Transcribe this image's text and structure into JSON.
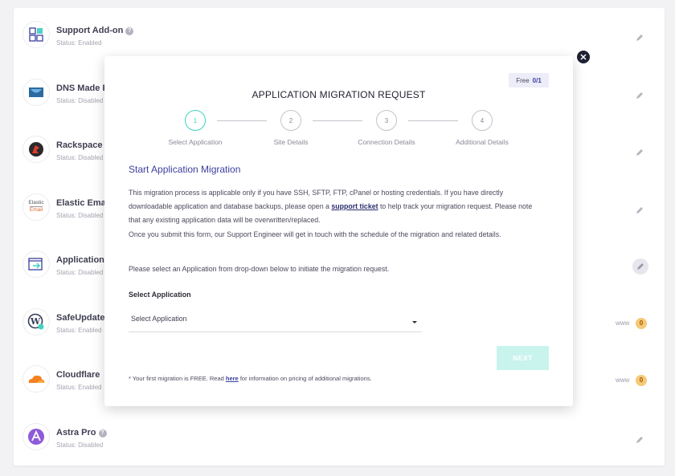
{
  "addons": [
    {
      "name": "Support Add-on",
      "status": "Status: Enabled",
      "icon": "support-grid-icon",
      "help": true
    },
    {
      "name": "DNS Made E",
      "status": "Status: Disabled",
      "icon": "dns-made-easy-icon",
      "help": false
    },
    {
      "name": "Rackspace E",
      "status": "Status: Disabled",
      "icon": "rackspace-icon",
      "help": false
    },
    {
      "name": "Elastic Emai",
      "status": "Status: Disabled",
      "icon": "elastic-email-icon",
      "icon_text_top": "Elastic",
      "icon_text_bottom": "Email",
      "help": false
    },
    {
      "name": "Application",
      "status": "Status: Disabled",
      "icon": "application-migration-icon",
      "help": false
    },
    {
      "name": "SafeUpdate",
      "status": "Status: Enabled",
      "icon": "wordpress-icon",
      "help": false,
      "www": "www",
      "count": "0"
    },
    {
      "name": "Cloudflare",
      "status": "Status: Enabled",
      "icon": "cloudflare-icon",
      "help": false,
      "www": "www",
      "count": "0"
    },
    {
      "name": "Astra Pro",
      "status": "Status: Disabled",
      "icon": "astra-icon",
      "help": true
    }
  ],
  "modal": {
    "free_label": "Free",
    "free_count": "0/1",
    "title": "APPLICATION MIGRATION REQUEST",
    "steps": [
      {
        "number": "1",
        "label": "Select Application"
      },
      {
        "number": "2",
        "label": "Site Details"
      },
      {
        "number": "3",
        "label": "Connection Details"
      },
      {
        "number": "4",
        "label": "Additional Details"
      }
    ],
    "section_title": "Start Application Migration",
    "desc_part1": "This migration process is applicable only if you have SSH, SFTP, FTP, cPanel or hosting credentials. If you have directly downloadable application and database backups, please open a ",
    "desc_link": "support ticket",
    "desc_part2": " to help track your migration request. Please note that any existing application data will be overwritten/replaced.",
    "desc_part3": "Once you submit this form, our Support Engineer will get in touch with the schedule of the migration and related details.",
    "desc_select": "Please select an Application from drop-down below to initiate the migration request.",
    "select_label": "Select Application",
    "select_value": "Select Application",
    "next_label": "NEXT",
    "footnote_part1": "* Your first migration is FREE. Read ",
    "footnote_link": "here",
    "footnote_part2": " for information on pricing of additional migrations."
  },
  "colors": {
    "accent": "#3b3f9e",
    "step_active": "#3fd4c0",
    "next_disabled": "#c9f4ee",
    "badge": "#f5c978"
  }
}
